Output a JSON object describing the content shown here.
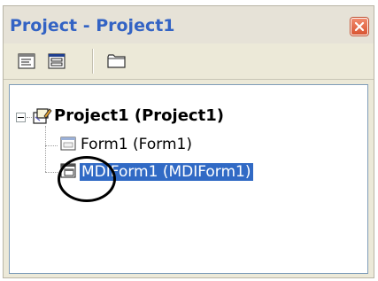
{
  "window": {
    "title": "Project - Project1"
  },
  "toolbar": {
    "buttons": [
      {
        "name": "view-code",
        "icon": "view-code-icon"
      },
      {
        "name": "view-object",
        "icon": "view-object-icon"
      },
      {
        "name": "toggle-folders",
        "icon": "folder-icon"
      }
    ]
  },
  "tree": {
    "root": {
      "label": "Project1 (Project1)",
      "expanded": true
    },
    "children": [
      {
        "label": "Form1 (Form1)",
        "selected": false
      },
      {
        "label": "MDIForm1 (MDIForm1)",
        "selected": true
      }
    ]
  },
  "colors": {
    "title_text": "#3363c4",
    "selection": "#316ac5",
    "close_button": "#d85532"
  }
}
